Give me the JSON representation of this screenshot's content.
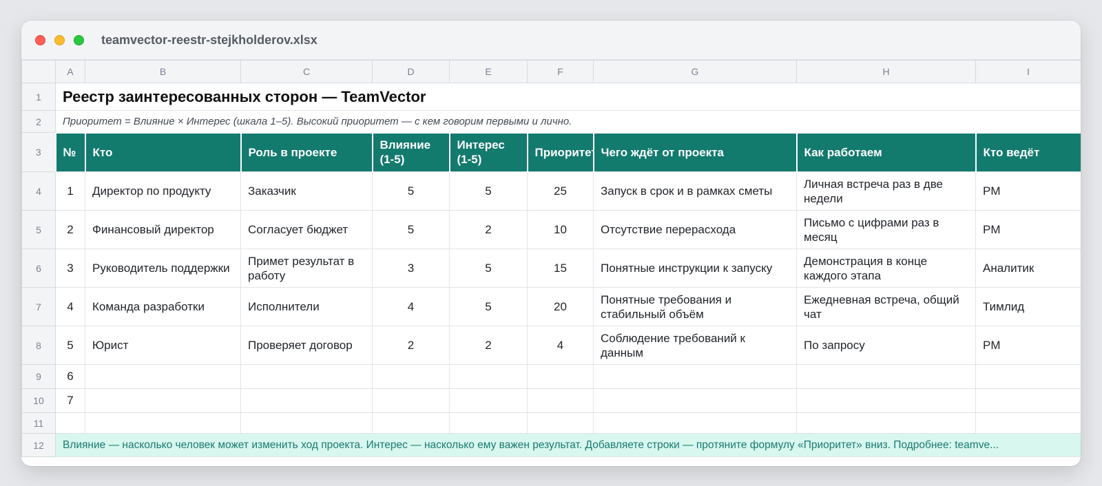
{
  "window": {
    "title": "teamvector-reestr-stejkholderov.xlsx"
  },
  "columns": [
    "A",
    "B",
    "C",
    "D",
    "E",
    "F",
    "G",
    "H",
    "I"
  ],
  "rows": [
    "1",
    "2",
    "3",
    "4",
    "5",
    "6",
    "7",
    "8",
    "9",
    "10",
    "11",
    "12"
  ],
  "sheet": {
    "title": "Реестр заинтересованных сторон — TeamVector",
    "subtitle": "Приоритет = Влияние × Интерес (шкала 1–5). Высокий приоритет — с кем говорим первыми и лично.",
    "headers": {
      "num": "№",
      "who": "Кто",
      "role": "Роль в проекте",
      "influence_1": "Влияние",
      "influence_2": "(1-5)",
      "interest_1": "Интерес",
      "interest_2": "(1-5)",
      "priority": "Приоритет",
      "expects": "Чего ждёт от проекта",
      "how": "Как работаем",
      "owner": "Кто ведёт"
    },
    "entries": [
      {
        "num": "1",
        "who": "Директор по продукту",
        "role": "Заказчик",
        "influence": "5",
        "interest": "5",
        "priority": "25",
        "expects": "Запуск в срок и в рамках сметы",
        "how": "Личная встреча раз в две недели",
        "owner": "PM"
      },
      {
        "num": "2",
        "who": "Финансовый директор",
        "role": "Согласует бюджет",
        "influence": "5",
        "interest": "2",
        "priority": "10",
        "expects": "Отсутствие перерасхода",
        "how": "Письмо с цифрами раз в месяц",
        "owner": "PM"
      },
      {
        "num": "3",
        "who": "Руководитель поддержки",
        "role": "Примет результат в работу",
        "influence": "3",
        "interest": "5",
        "priority": "15",
        "expects": "Понятные инструкции к запуску",
        "how": "Демонстрация в конце каждого этапа",
        "owner": "Аналитик"
      },
      {
        "num": "4",
        "who": "Команда разработки",
        "role": "Исполнители",
        "influence": "4",
        "interest": "5",
        "priority": "20",
        "expects": "Понятные требования и стабильный объём",
        "how": "Ежедневная встреча, общий чат",
        "owner": "Тимлид"
      },
      {
        "num": "5",
        "who": "Юрист",
        "role": "Проверяет договор",
        "influence": "2",
        "interest": "2",
        "priority": "4",
        "expects": "Соблюдение требований к данным",
        "how": "По запросу",
        "owner": "PM"
      }
    ],
    "empty_nums": [
      "6",
      "7"
    ],
    "footer_note": "Влияние — насколько человек может изменить ход проекта. Интерес — насколько ему важен результат. Добавляете строки — протяните формулу «Приоритет» вниз. Подробнее: teamve..."
  },
  "colors": {
    "header_fill": "#137a6e",
    "note_fill": "#d7f7ef",
    "note_text": "#1b7a6d"
  }
}
